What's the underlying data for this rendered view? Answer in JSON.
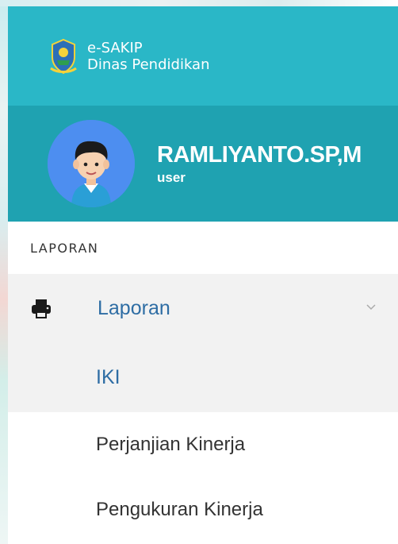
{
  "brand": {
    "line1": "e-SAKIP",
    "line2": "Dinas Pendidikan",
    "logo_icon": "regional-emblem-logo"
  },
  "user": {
    "name": "RAMLIYANTO.SP,M",
    "role": "user",
    "avatar_icon": "user-avatar"
  },
  "menu": {
    "section_header": "LAPORAN",
    "parent": {
      "label": "Laporan",
      "icon": "printer-icon",
      "expanded": true
    },
    "items": [
      {
        "label": "IKI",
        "active": true
      },
      {
        "label": "Perjanjian Kinerja",
        "active": false
      },
      {
        "label": "Pengukuran Kinerja",
        "active": false
      }
    ]
  },
  "colors": {
    "brand_bg": "#2ab7c7",
    "user_bg": "#1fa2b1",
    "link": "#2e6da4",
    "active_bg": "#f2f2f2"
  }
}
